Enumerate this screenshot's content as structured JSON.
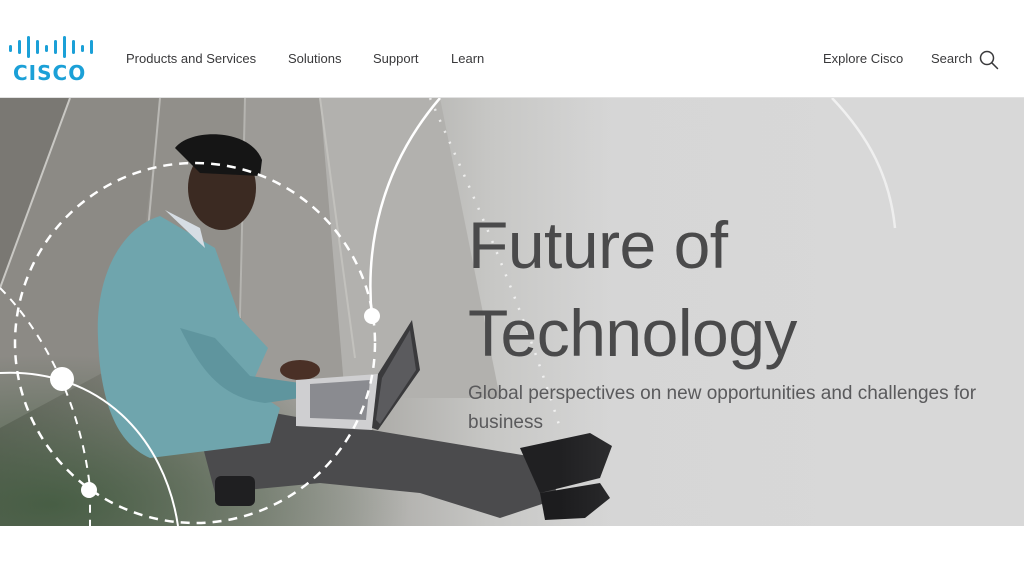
{
  "brand": {
    "name": "Cisco",
    "logo_text": "CISCO",
    "logo_color": "#1ba0d7"
  },
  "nav": {
    "items": [
      {
        "label": "Products and Services"
      },
      {
        "label": "Solutions"
      },
      {
        "label": "Support"
      },
      {
        "label": "Learn"
      }
    ]
  },
  "utility": {
    "explore_label": "Explore Cisco",
    "search_label": "Search",
    "search_icon": "search-icon"
  },
  "hero": {
    "title_line1": "Future of",
    "title_line2": "Technology",
    "subtitle": "Global perspectives on new opportunities and challenges for business",
    "image_description": "Man in light blue sweater sitting on concrete steps typing on a laptop, with white dashed circular network graphic overlay"
  },
  "colors": {
    "text_primary": "#39393b",
    "hero_title": "#4a4a4b",
    "hero_background": "#d9d9d9"
  }
}
